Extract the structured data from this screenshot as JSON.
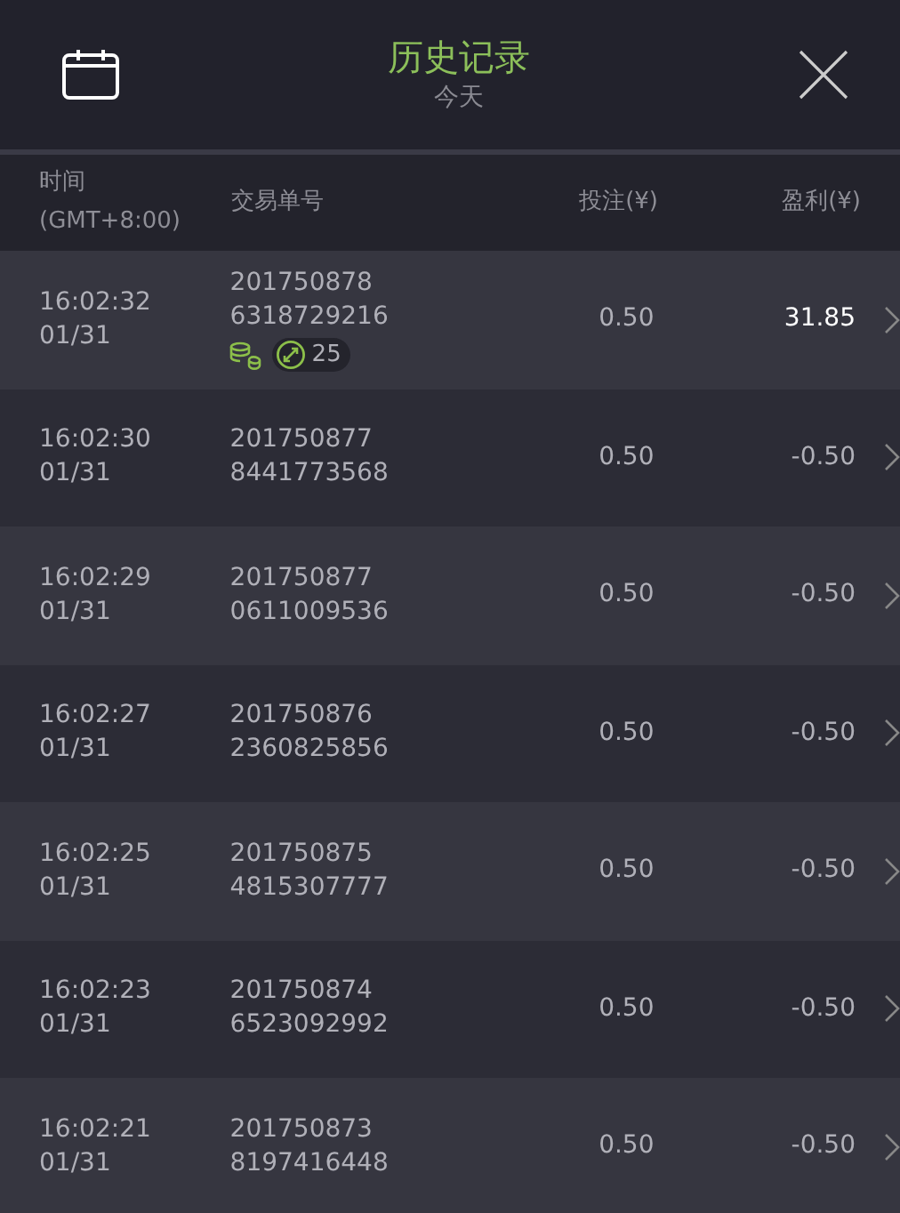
{
  "header": {
    "title": "历史记录",
    "subtitle": "今天"
  },
  "columns": [
    {
      "lines": [
        "时间",
        "(GMT+8:00)"
      ]
    },
    {
      "lines": [
        "交易单号"
      ]
    },
    {
      "lines": [
        "投注(¥)"
      ]
    },
    {
      "lines": [
        "盈利(¥)"
      ]
    }
  ],
  "rows": [
    {
      "time": "16:02:32",
      "date": "01/31",
      "order": [
        "201750878",
        "6318729216"
      ],
      "stake": "0.50",
      "profit": "31.85",
      "win": true,
      "badge": "25"
    },
    {
      "time": "16:02:30",
      "date": "01/31",
      "order": [
        "201750877",
        "8441773568"
      ],
      "stake": "0.50",
      "profit": "-0.50",
      "win": false
    },
    {
      "time": "16:02:29",
      "date": "01/31",
      "order": [
        "201750877",
        "0611009536"
      ],
      "stake": "0.50",
      "profit": "-0.50",
      "win": false
    },
    {
      "time": "16:02:27",
      "date": "01/31",
      "order": [
        "201750876",
        "2360825856"
      ],
      "stake": "0.50",
      "profit": "-0.50",
      "win": false
    },
    {
      "time": "16:02:25",
      "date": "01/31",
      "order": [
        "201750875",
        "4815307777"
      ],
      "stake": "0.50",
      "profit": "-0.50",
      "win": false
    },
    {
      "time": "16:02:23",
      "date": "01/31",
      "order": [
        "201750874",
        "6523092992"
      ],
      "stake": "0.50",
      "profit": "-0.50",
      "win": false
    },
    {
      "time": "16:02:21",
      "date": "01/31",
      "order": [
        "201750873",
        "8197416448"
      ],
      "stake": "0.50",
      "profit": "-0.50",
      "win": false
    }
  ]
}
